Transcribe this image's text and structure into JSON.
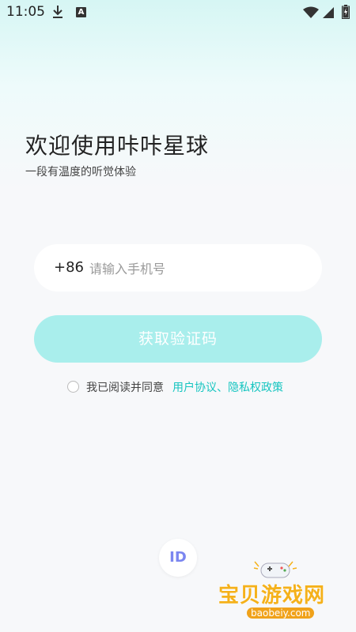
{
  "status_bar": {
    "time": "11:05",
    "icons": [
      "download-icon",
      "a-icon",
      "wifi-icon",
      "signal-icon",
      "battery-icon"
    ],
    "a_icon_letter": "A"
  },
  "welcome": {
    "title": "欢迎使用咔咔星球",
    "subtitle": "一段有温度的听觉体验"
  },
  "phone": {
    "country_code": "+86",
    "placeholder": "请输入手机号",
    "value": ""
  },
  "actions": {
    "get_code_label": "获取验证码"
  },
  "agreement": {
    "checked": false,
    "text": "我已阅读并同意",
    "links": "用户协议、隐私权政策"
  },
  "id_login": {
    "label": "ID"
  },
  "watermark": {
    "site_name": "宝贝游戏网",
    "url": "baobeiy.com"
  },
  "colors": {
    "accent": "#16c5c0",
    "button_bg": "#a9eeec",
    "id_icon": "#7b86f0",
    "watermark": "#f5b11a"
  }
}
